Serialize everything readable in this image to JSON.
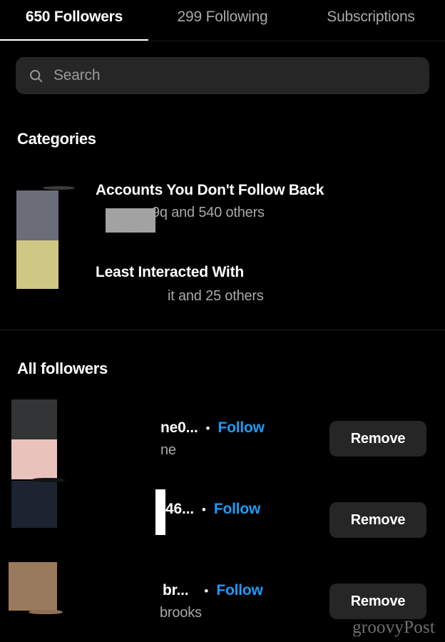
{
  "tabs": [
    {
      "label": "650 Followers",
      "active": true
    },
    {
      "label": "299 Following",
      "active": false
    },
    {
      "label": "Subscriptions",
      "active": false
    }
  ],
  "search": {
    "placeholder": "Search",
    "value": "",
    "icon": "search-icon"
  },
  "categories_section": {
    "title": "Categories",
    "items": [
      {
        "title": "Accounts You Don't Follow Back",
        "subtitle": "9q and 540 others",
        "avatar_colors": [
          "#6b6d78",
          "#cec884"
        ]
      },
      {
        "title": "Least Interacted With",
        "subtitle": "it and 25 others",
        "avatar_colors": []
      }
    ]
  },
  "all_followers_section": {
    "title": "All followers",
    "follow_label": "Follow",
    "remove_label": "Remove",
    "separator_dot": "•",
    "rows": [
      {
        "username": "ne0...",
        "fullname": "ne",
        "avatar_colors": [
          "#333436",
          "#e8c2bb"
        ]
      },
      {
        "username": "46...",
        "fullname": "",
        "avatar_colors": [
          "#1b2430"
        ]
      },
      {
        "username": "br...",
        "fullname": "brooks",
        "avatar_colors": [
          "#9a7a5d"
        ]
      }
    ]
  },
  "watermark": {
    "text": "groovyPost"
  },
  "colors": {
    "background": "#000000",
    "field": "#262626",
    "link_blue": "#1d9bf6",
    "text_primary": "#ffffff",
    "text_secondary": "#a8a8a8",
    "divider": "#1c1c1c"
  }
}
